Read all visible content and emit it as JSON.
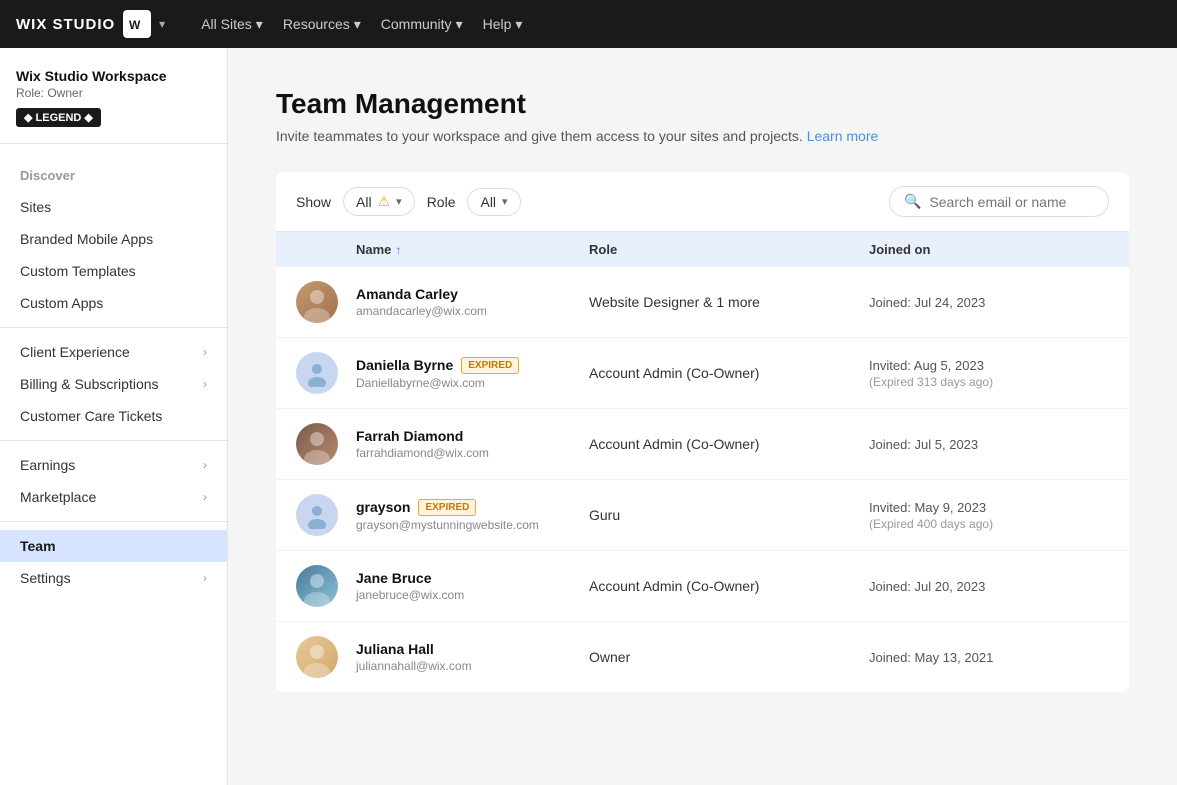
{
  "topnav": {
    "logo_text": "WIX STUDIO",
    "logo_badge": "W",
    "nav_items": [
      {
        "label": "All Sites",
        "has_chevron": true
      },
      {
        "label": "Resources",
        "has_chevron": true
      },
      {
        "label": "Community",
        "has_chevron": true
      },
      {
        "label": "Help",
        "has_chevron": true
      }
    ]
  },
  "sidebar": {
    "workspace_name": "Wix Studio Workspace",
    "workspace_role": "Role: Owner",
    "badge_label": "◆ LEGEND ◆",
    "discover_label": "Discover",
    "items": [
      {
        "id": "sites",
        "label": "Sites",
        "has_chevron": false
      },
      {
        "id": "branded-mobile-apps",
        "label": "Branded Mobile Apps",
        "has_chevron": false
      },
      {
        "id": "custom-templates",
        "label": "Custom Templates",
        "has_chevron": false
      },
      {
        "id": "custom-apps",
        "label": "Custom Apps",
        "has_chevron": false
      },
      {
        "id": "client-experience",
        "label": "Client Experience",
        "has_chevron": true
      },
      {
        "id": "billing-subscriptions",
        "label": "Billing & Subscriptions",
        "has_chevron": true
      },
      {
        "id": "customer-care-tickets",
        "label": "Customer Care Tickets",
        "has_chevron": false
      },
      {
        "id": "earnings",
        "label": "Earnings",
        "has_chevron": true
      },
      {
        "id": "marketplace",
        "label": "Marketplace",
        "has_chevron": true
      },
      {
        "id": "team",
        "label": "Team",
        "has_chevron": false,
        "active": true
      },
      {
        "id": "settings",
        "label": "Settings",
        "has_chevron": true
      }
    ]
  },
  "page": {
    "title": "Team Management",
    "subtitle": "Invite teammates to your workspace and give them access to your sites and projects.",
    "learn_more": "Learn more"
  },
  "filter": {
    "show_label": "Show",
    "show_value": "All",
    "role_label": "Role",
    "role_value": "All",
    "search_placeholder": "Search email or name"
  },
  "table": {
    "columns": {
      "name": "Name",
      "role": "Role",
      "joined": "Joined on"
    },
    "members": [
      {
        "id": "amanda",
        "name": "Amanda Carley",
        "email": "amandacarley@wix.com",
        "role": "Website Designer & 1 more",
        "joined_label": "Joined: Jul 24, 2023",
        "joined_sub": "",
        "expired": false,
        "avatar_type": "photo",
        "avatar_class": "avatar-amanda"
      },
      {
        "id": "daniella",
        "name": "Daniella Byrne",
        "email": "Daniellabyrne@wix.com",
        "role": "Account Admin (Co-Owner)",
        "joined_label": "Invited: Aug 5, 2023",
        "joined_sub": "(Expired 313 days ago)",
        "expired": true,
        "avatar_type": "placeholder",
        "avatar_class": ""
      },
      {
        "id": "farrah",
        "name": "Farrah Diamond",
        "email": "farrahdiamond@wix.com",
        "role": "Account Admin (Co-Owner)",
        "joined_label": "Joined: Jul 5, 2023",
        "joined_sub": "",
        "expired": false,
        "avatar_type": "photo",
        "avatar_class": "avatar-farrah"
      },
      {
        "id": "grayson",
        "name": "grayson",
        "email": "grayson@mystunningwebsite.com",
        "role": "Guru",
        "joined_label": "Invited: May 9, 2023",
        "joined_sub": "(Expired 400 days ago)",
        "expired": true,
        "avatar_type": "placeholder",
        "avatar_class": ""
      },
      {
        "id": "jane",
        "name": "Jane Bruce",
        "email": "janebruce@wix.com",
        "role": "Account Admin (Co-Owner)",
        "joined_label": "Joined: Jul 20, 2023",
        "joined_sub": "",
        "expired": false,
        "avatar_type": "photo",
        "avatar_class": "avatar-jane"
      },
      {
        "id": "juliana",
        "name": "Juliana Hall",
        "email": "juliannahall@wix.com",
        "role": "Owner",
        "joined_label": "Joined: May 13, 2021",
        "joined_sub": "",
        "expired": false,
        "avatar_type": "photo",
        "avatar_class": "avatar-juliana"
      }
    ]
  }
}
